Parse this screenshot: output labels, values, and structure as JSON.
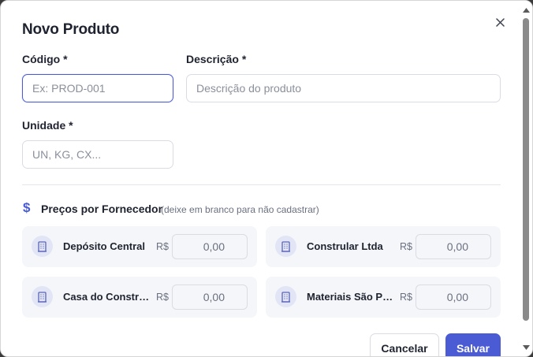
{
  "modal": {
    "title": "Novo Produto",
    "close_icon": "close-icon"
  },
  "form": {
    "codigo": {
      "label": "Código *",
      "placeholder": "Ex: PROD-001",
      "value": ""
    },
    "descricao": {
      "label": "Descrição *",
      "placeholder": "Descrição do produto",
      "value": ""
    },
    "unidade": {
      "label": "Unidade *",
      "placeholder": "UN, KG, CX...",
      "value": ""
    }
  },
  "precos": {
    "icon": "dollar-icon",
    "title": "Preços por Fornecedor",
    "hint": "(deixe em branco para não cadastrar)",
    "currency": "R$",
    "fornecedores": [
      {
        "name": "Depósito Central",
        "price": "0,00"
      },
      {
        "name": "Constrular Ltda",
        "price": "0,00"
      },
      {
        "name": "Casa do Construtor",
        "price": "0,00"
      },
      {
        "name": "Materiais São Paulo",
        "price": "0,00"
      }
    ]
  },
  "actions": {
    "cancel": "Cancelar",
    "save": "Salvar"
  },
  "colors": {
    "accent": "#4a5bd4",
    "text": "#1f2330",
    "muted": "#6b7080"
  }
}
